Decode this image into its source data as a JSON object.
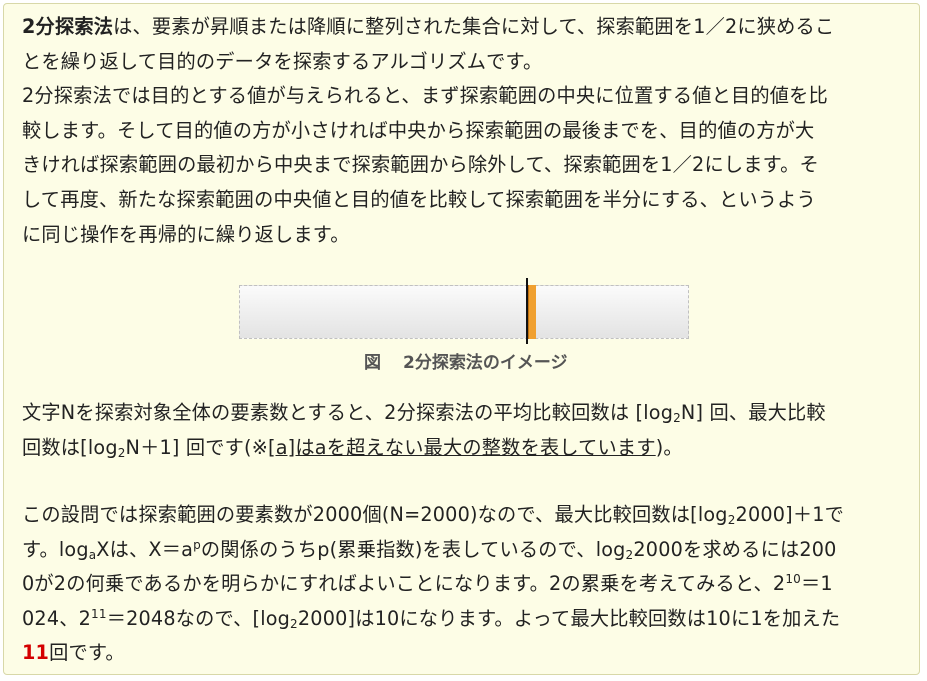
{
  "para1": {
    "l1_bold": "2分探索法",
    "l1_rest": "は、要素が昇順または降順に整列された集合に対して、探索範囲を1／2に狭めるこ",
    "l2": "とを繰り返して目的のデータを探索するアルゴリズムです。",
    "l3": "2分探索法では目的とする値が与えられると、まず探索範囲の中央に位置する値と目的値を比",
    "l4": "較します。そして目的値の方が小さければ中央から探索範囲の最後までを、目的値の方が大",
    "l5": "きければ探索範囲の最初から中央まで探索範囲から除外して、探索範囲を1／2にします。そ",
    "l6": "して再度、新たな探索範囲の中央値と目的値を比較して探索範囲を半分にする、というよう",
    "l7": "に同じ操作を再帰的に繰り返します。"
  },
  "figure": {
    "caption_label": "図",
    "caption_text": "2分探索法のイメージ",
    "colors": {
      "marker": "#f0a030",
      "midline": "#111111"
    }
  },
  "para2": {
    "l1_a": "文字Nを探索対象全体の要素数とすると、2分探索法の平均比較回数は [log",
    "l1_sub": "2",
    "l1_b": "N] 回、最大比較",
    "l2_a": "回数は[log",
    "l2_sub": "2",
    "l2_b": "N＋1] 回です(※",
    "l2_u": "[a]はaを超えない最大の整数を表しています",
    "l2_c": ")。"
  },
  "para3": {
    "l1_a": "この設問では探索範囲の要素数が2000個(N=2000)なので、最大比較回数は[log",
    "l1_sub": "2",
    "l1_b": "2000]＋1で",
    "l2_a": "す。log",
    "l2_sub1": "a",
    "l2_b": "Xは、X＝a",
    "l2_sup": "p",
    "l2_c": "の関係のうちp(累乗指数)を表しているので、log",
    "l2_sub2": "2",
    "l2_d": "2000を求めるには200",
    "l3_a": "0が2の何乗であるかを明らかにすればよいことになります。2の累乗を考えてみると、2",
    "l3_sup": "10",
    "l3_b": "＝1",
    "l4_a": "024、2",
    "l4_sup": "11",
    "l4_b": "＝2048なので、[log",
    "l4_sub": "2",
    "l4_c": "2000]は10になります。よって最大比較回数は10に1を加えた",
    "l5_red": "11",
    "l5_b": "回です。",
    "colors": {
      "answer": "#d40000"
    }
  }
}
